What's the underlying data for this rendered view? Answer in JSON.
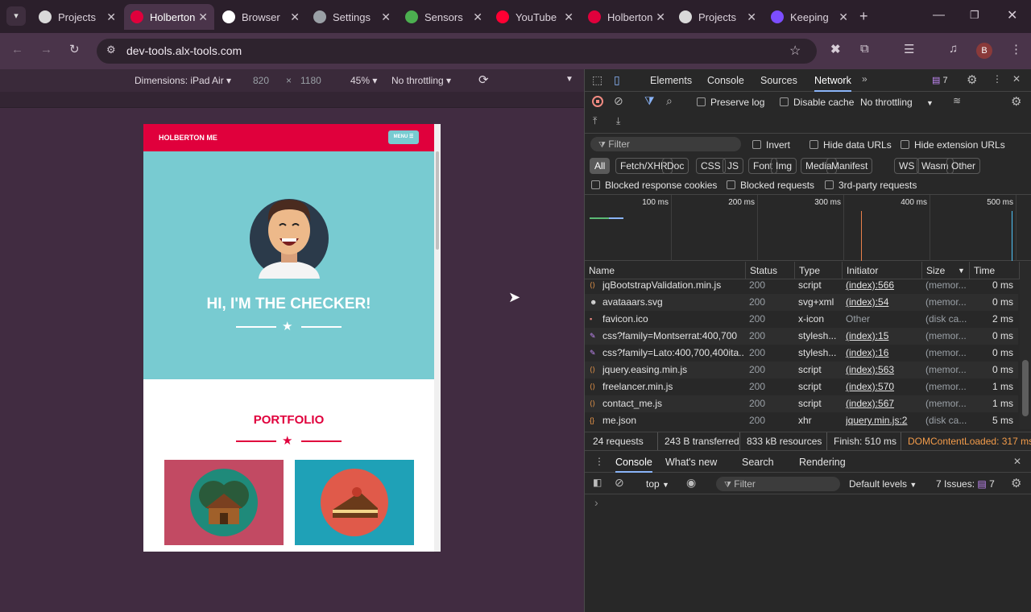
{
  "browser": {
    "tabs": [
      {
        "title": "Projects",
        "icon": "alx-icon",
        "color": "#d9d9d9"
      },
      {
        "title": "Holberton",
        "icon": "holberton-icon",
        "color": "#e0003c",
        "active": true
      },
      {
        "title": "Browser",
        "icon": "openai-icon",
        "color": "#ffffff"
      },
      {
        "title": "Settings",
        "icon": "book-icon",
        "color": "#9aa0a6"
      },
      {
        "title": "Sensors",
        "icon": "chrome-icon",
        "color": "#4caf50"
      },
      {
        "title": "YouTube",
        "icon": "youtube-icon",
        "color": "#ff0033"
      },
      {
        "title": "Holberton",
        "icon": "holberton-icon",
        "color": "#e0003c"
      },
      {
        "title": "Projects",
        "icon": "alx-icon",
        "color": "#d9d9d9"
      },
      {
        "title": "Keeping",
        "icon": "keeping-icon",
        "color": "#7c4dff"
      }
    ],
    "url": "dev-tools.alx-tools.com",
    "profile_initial": "B"
  },
  "device_toolbar": {
    "dimensions": "Dimensions: iPad Air",
    "width": "820",
    "x": "×",
    "height": "1180",
    "zoom": "45%",
    "throttling": "No throttling"
  },
  "site": {
    "brand": "HOLBERTON ME",
    "menu": "MENU ☰",
    "heading": "HI, I'M THE CHECKER!",
    "portfolio": "PORTFOLIO",
    "colors": {
      "header": "#e0003c",
      "hero": "#78cbd1",
      "card1": "#c24a63",
      "card2": "#1fa1b7"
    }
  },
  "devtools": {
    "tabs": [
      "Elements",
      "Console",
      "Sources",
      "Network"
    ],
    "active_tab": "Network",
    "issues_count": "7",
    "preserve_log": "Preserve log",
    "disable_cache": "Disable cache",
    "throttling": "No throttling",
    "filter_placeholder": "Filter",
    "invert": "Invert",
    "hide_data_urls": "Hide data URLs",
    "hide_ext_urls": "Hide extension URLs",
    "type_filters": [
      "All",
      "Fetch/XHR",
      "Doc",
      "CSS",
      "JS",
      "Font",
      "Img",
      "Media",
      "Manifest",
      "WS",
      "Wasm",
      "Other"
    ],
    "blocked_cookies": "Blocked response cookies",
    "blocked_requests": "Blocked requests",
    "third_party": "3rd-party requests",
    "timeline_ticks": [
      "100 ms",
      "200 ms",
      "300 ms",
      "400 ms",
      "500 ms"
    ],
    "columns": [
      "Name",
      "Status",
      "Type",
      "Initiator",
      "Size",
      "Time"
    ],
    "requests": [
      {
        "name": "jqBootstrapValidation.min.js",
        "status": "200",
        "type": "script",
        "initiator": "(index):566",
        "size": "(memor...",
        "time": "0 ms",
        "icon": "script-icon"
      },
      {
        "name": "avataaars.svg",
        "status": "200",
        "type": "svg+xml",
        "initiator": "(index):54",
        "size": "(memor...",
        "time": "0 ms",
        "icon": "image-icon"
      },
      {
        "name": "favicon.ico",
        "status": "200",
        "type": "x-icon",
        "initiator": "Other",
        "size": "(disk ca...",
        "time": "2 ms",
        "icon": "favicon-icon"
      },
      {
        "name": "css?family=Montserrat:400,700",
        "status": "200",
        "type": "stylesh...",
        "initiator": "(index):15",
        "size": "(memor...",
        "time": "0 ms",
        "icon": "stylesheet-icon"
      },
      {
        "name": "css?family=Lato:400,700,400ita...",
        "status": "200",
        "type": "stylesh...",
        "initiator": "(index):16",
        "size": "(memor...",
        "time": "0 ms",
        "icon": "stylesheet-icon"
      },
      {
        "name": "jquery.easing.min.js",
        "status": "200",
        "type": "script",
        "initiator": "(index):563",
        "size": "(memor...",
        "time": "0 ms",
        "icon": "script-icon"
      },
      {
        "name": "freelancer.min.js",
        "status": "200",
        "type": "script",
        "initiator": "(index):570",
        "size": "(memor...",
        "time": "1 ms",
        "icon": "script-icon"
      },
      {
        "name": "contact_me.js",
        "status": "200",
        "type": "script",
        "initiator": "(index):567",
        "size": "(memor...",
        "time": "1 ms",
        "icon": "script-icon"
      },
      {
        "name": "me.json",
        "status": "200",
        "type": "xhr",
        "initiator": "jquery.min.js:2",
        "size": "(disk ca...",
        "time": "5 ms",
        "icon": "xhr-icon"
      }
    ],
    "summary": {
      "requests": "24 requests",
      "transferred": "243 B transferred",
      "resources": "833 kB resources",
      "finish": "Finish: 510 ms",
      "dcl": "DOMContentLoaded: 317 ms"
    },
    "drawer_tabs": [
      "Console",
      "What's new",
      "Search",
      "Rendering"
    ],
    "console": {
      "context": "top",
      "filter": "Filter",
      "levels": "Default levels",
      "issues": "7 Issues:",
      "issues_count": "7",
      "prompt": "›"
    }
  }
}
